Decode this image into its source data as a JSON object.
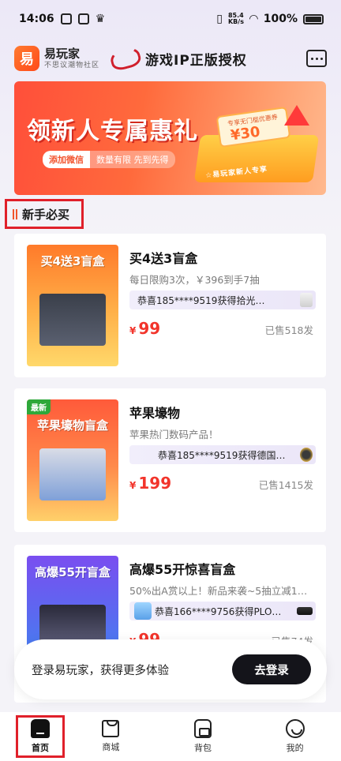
{
  "status_bar": {
    "time": "14:06",
    "net_speed_value": "85.4",
    "net_speed_unit": "KB/s",
    "battery": "100%"
  },
  "header": {
    "logo_glyph": "易",
    "app_name": "易玩家",
    "app_slogan": "不思议潮物社区",
    "ip_text": "游戏IP正版授权"
  },
  "banner": {
    "title": "领新人专属惠礼",
    "pill_primary": "添加微信",
    "pill_secondary": "数量有限 先到先得",
    "coupon_label": "专享无门槛优惠券",
    "coupon_value": "¥30",
    "strip_text": "☆易玩家新人专享"
  },
  "section": {
    "title": "新手必买"
  },
  "products": [
    {
      "thumb_title": "买4送3盲盒",
      "thumb_tag": "",
      "name": "买4送3盲盒",
      "desc": "每日限购3次，￥396到手7抽",
      "ticker": "恭喜185****9519获得拾光…",
      "currency": "¥",
      "price": "99",
      "sold": "已售518发",
      "thumb_color_top": "#ff7a2a",
      "thumb_color_bottom": "#ffcf5a"
    },
    {
      "thumb_title": "苹果壕物盲盒",
      "thumb_tag": "最新",
      "name": "苹果壕物",
      "desc": "苹果热门数码产品！",
      "ticker": "恭喜185****9519获得德国…",
      "currency": "¥",
      "price": "199",
      "sold": "已售1415发",
      "thumb_color_top": "#ff5a3a",
      "thumb_color_bottom": "#ffd06a"
    },
    {
      "thumb_title": "高爆55开盲盒",
      "thumb_tag": "",
      "name": "高爆55开惊喜盲盒",
      "desc": "50%出A赏以上！新品来袭~5抽立减1…",
      "ticker": "恭喜166****9756获得PLO…",
      "currency": "¥",
      "price": "99",
      "sold": "已售74发",
      "thumb_color_top": "#7a4ef0",
      "thumb_color_bottom": "#3a7af0"
    }
  ],
  "login_bar": {
    "text": "登录易玩家，获得更多体验",
    "button": "去登录"
  },
  "bottom_nav": [
    {
      "label": "首页",
      "icon": "home-icon"
    },
    {
      "label": "商城",
      "icon": "shop-bag-icon"
    },
    {
      "label": "背包",
      "icon": "backpack-icon"
    },
    {
      "label": "我的",
      "icon": "profile-icon"
    }
  ],
  "colors": {
    "accent_red": "#f2342b",
    "highlight_border": "#e0202a",
    "login_button": "#14141a"
  }
}
